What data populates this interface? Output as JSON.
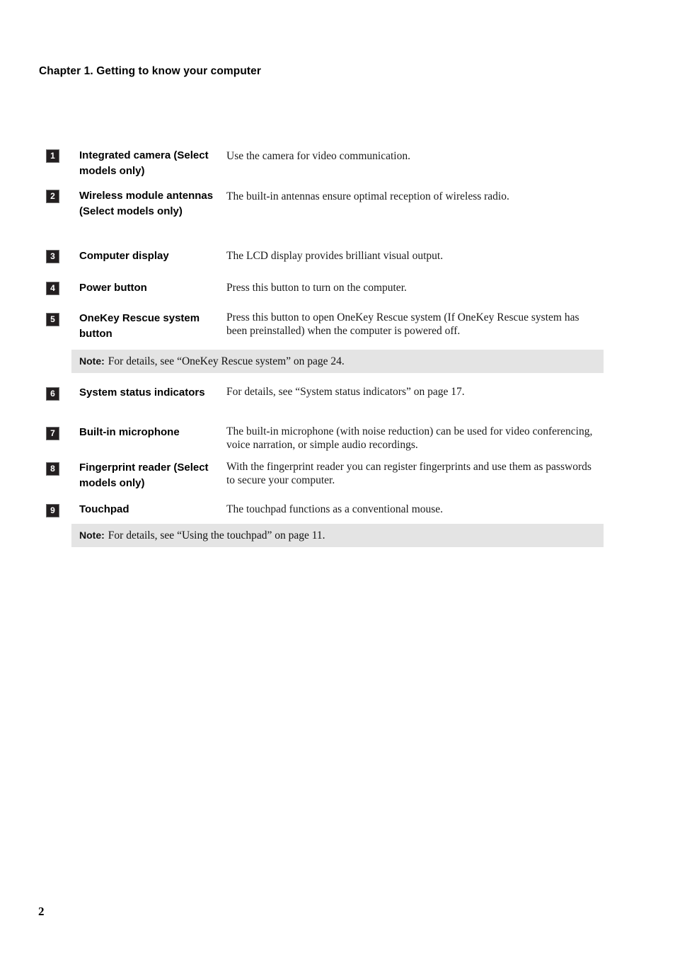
{
  "document": {
    "chapter_header": "Chapter 1. Getting to know your computer",
    "page_number": "2",
    "note_background_color": "#e4e4e4",
    "badge_color": "#231f20"
  },
  "features": [
    {
      "number": "1",
      "label": "Integrated camera (Select models only)",
      "description": "Use the camera for video communication."
    },
    {
      "number": "2",
      "label": "Wireless module antennas (Select models only)",
      "description": "The built-in antennas ensure optimal reception of wireless radio."
    },
    {
      "number": "3",
      "label": "Computer display",
      "description": "The LCD display provides brilliant visual output."
    },
    {
      "number": "4",
      "label": "Power button",
      "description": "Press this button to turn on the computer."
    },
    {
      "number": "5",
      "label": "OneKey Rescue system button",
      "description": "Press this button to open OneKey Rescue system (If OneKey Rescue system has been preinstalled) when the computer is powered off."
    },
    {
      "number": "6",
      "label": "System status indicators",
      "description": "For details, see “System status indicators” on page 17."
    },
    {
      "number": "7",
      "label": "Built-in microphone",
      "description": "The built-in microphone (with noise reduction) can be used for video conferencing, voice narration, or simple audio recordings."
    },
    {
      "number": "8",
      "label": "Fingerprint reader (Select models only)",
      "description": "With the fingerprint reader you can register fingerprints and use them as passwords to secure your computer."
    },
    {
      "number": "9",
      "label": "Touchpad",
      "description": "The touchpad functions as a conventional mouse."
    }
  ],
  "notes": [
    {
      "label": "Note:",
      "text": "For details, see “OneKey Rescue system” on page 24."
    },
    {
      "label": "Note:",
      "text": "For details, see “Using the touchpad” on page 11."
    }
  ]
}
